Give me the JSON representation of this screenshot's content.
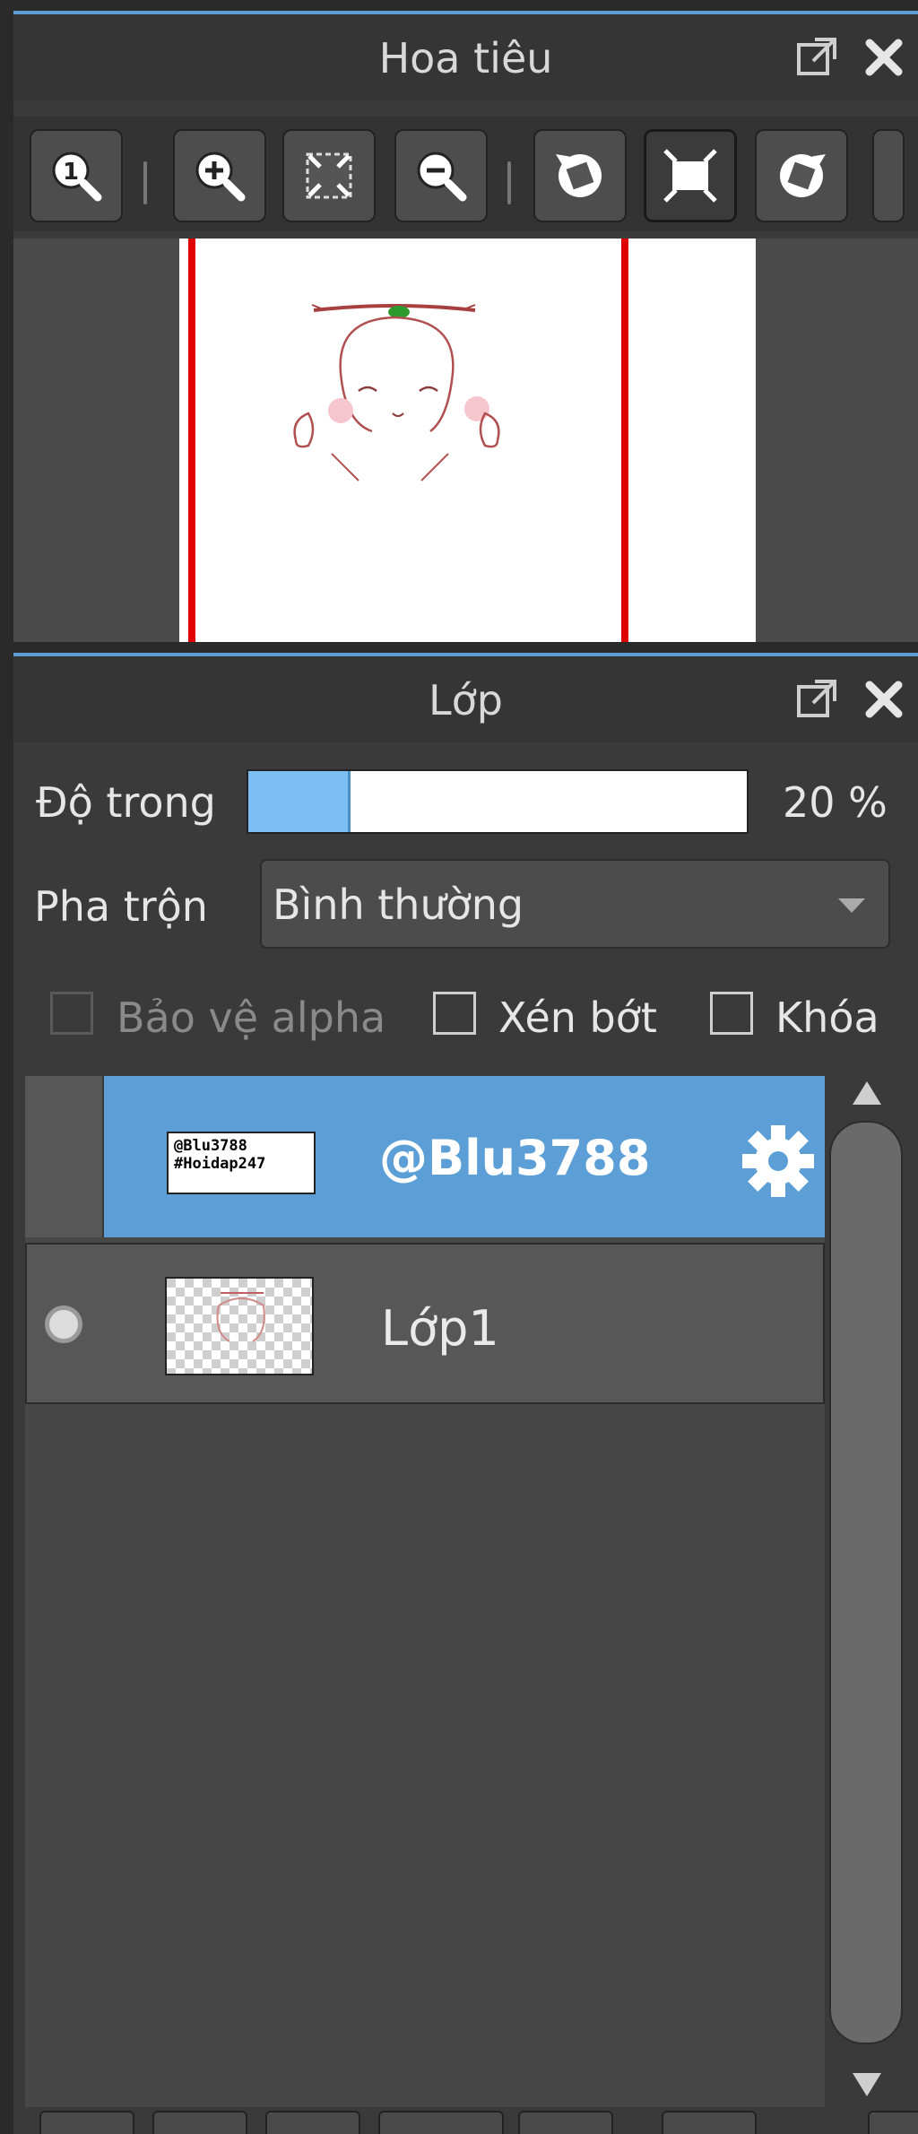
{
  "navigator": {
    "title": "Hoa tiêu",
    "toolbar": {
      "buttons": [
        {
          "icon": "zoom-actual-icon"
        },
        {
          "icon": "zoom-in-icon"
        },
        {
          "icon": "fit-to-window-icon"
        },
        {
          "icon": "zoom-out-icon"
        },
        {
          "icon": "rotate-left-icon"
        },
        {
          "icon": "fit-canvas-icon"
        },
        {
          "icon": "rotate-right-icon"
        }
      ]
    }
  },
  "layers": {
    "title": "Lớp",
    "opacity": {
      "label": "Độ trong",
      "value_text": "20 %",
      "value": 20
    },
    "blend": {
      "label": "Pha trộn",
      "value": "Bình thường"
    },
    "checkboxes": {
      "protect_alpha": {
        "label": "Bảo vệ alpha",
        "enabled": false,
        "checked": false
      },
      "clipping": {
        "label": "Xén bớt",
        "checked": false
      },
      "lock": {
        "label": "Khóa",
        "checked": false
      }
    },
    "items": [
      {
        "name": "@Blu3788",
        "selected": true,
        "thumb_text_1": "@Blu3788",
        "thumb_text_2": "#Hoidap247"
      },
      {
        "name": "Lớp1",
        "selected": false,
        "visible": true
      }
    ]
  },
  "colors": {
    "accent": "#5b9fd6",
    "selection": "#5b9fd6",
    "slider_fill": "#7dbff5",
    "guide_line": "#e00000"
  }
}
